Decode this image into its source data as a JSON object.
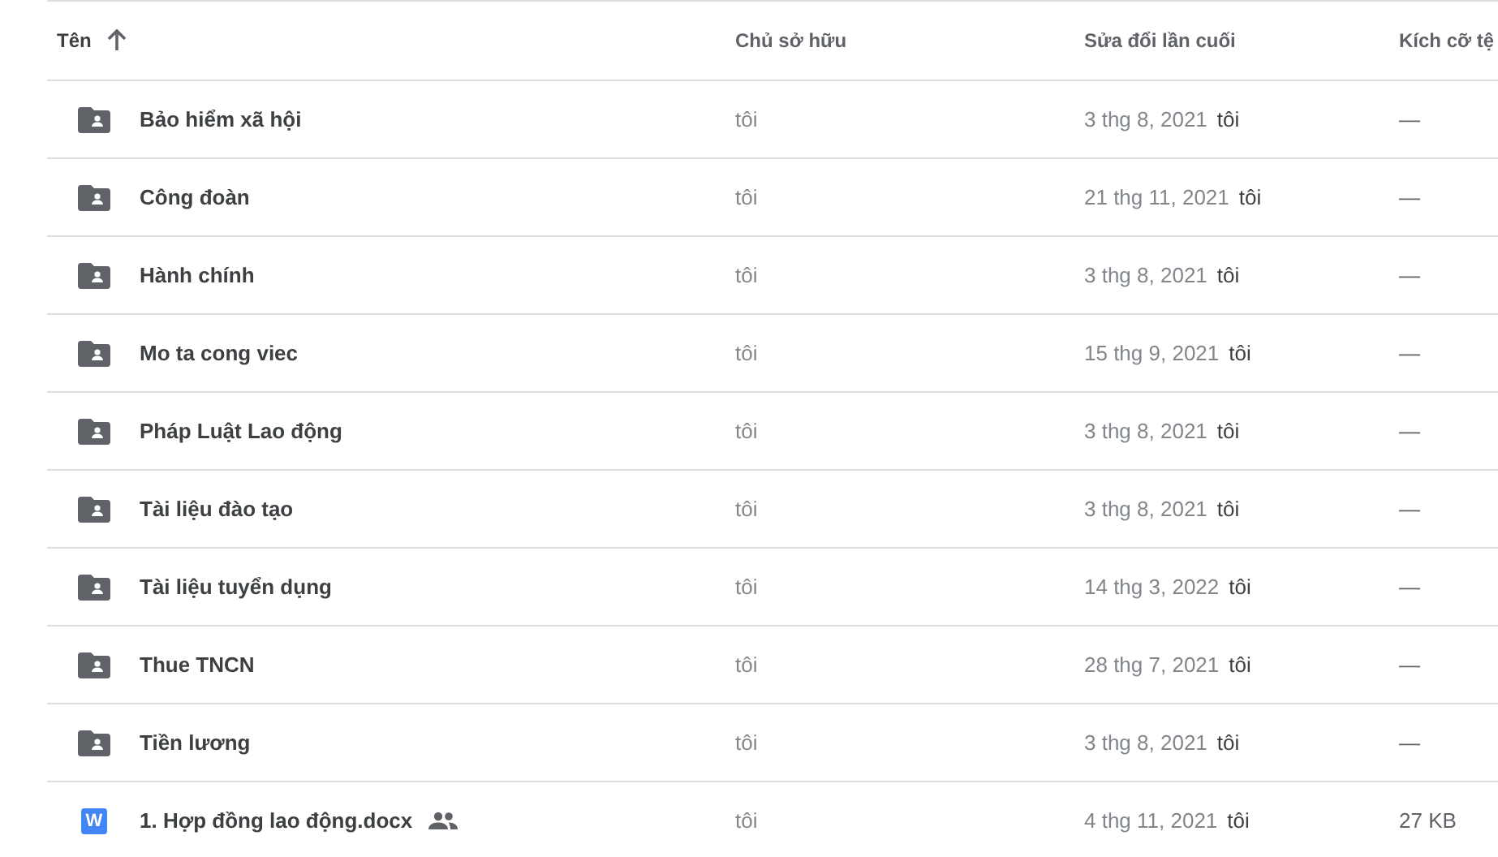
{
  "columns": [
    {
      "label": "Tên",
      "sorted": true
    },
    {
      "label": "Chủ sở hữu",
      "sorted": false
    },
    {
      "label": "Sửa đổi lần cuối",
      "sorted": false
    },
    {
      "label": "Kích cỡ tệ",
      "sorted": false
    }
  ],
  "rows": [
    {
      "kind": "folder",
      "name": "Bảo hiểm xã hội",
      "owner": "tôi",
      "modified": "3 thg 8, 2021",
      "modified_by": "tôi",
      "size": "—",
      "shared": false
    },
    {
      "kind": "folder",
      "name": "Công đoàn",
      "owner": "tôi",
      "modified": "21 thg 11, 2021",
      "modified_by": "tôi",
      "size": "—",
      "shared": false
    },
    {
      "kind": "folder",
      "name": "Hành chính",
      "owner": "tôi",
      "modified": "3 thg 8, 2021",
      "modified_by": "tôi",
      "size": "—",
      "shared": false
    },
    {
      "kind": "folder",
      "name": "Mo ta cong viec",
      "owner": "tôi",
      "modified": "15 thg 9, 2021",
      "modified_by": "tôi",
      "size": "—",
      "shared": false
    },
    {
      "kind": "folder",
      "name": "Pháp Luật Lao động",
      "owner": "tôi",
      "modified": "3 thg 8, 2021",
      "modified_by": "tôi",
      "size": "—",
      "shared": false
    },
    {
      "kind": "folder",
      "name": "Tài liệu đào tạo",
      "owner": "tôi",
      "modified": "3 thg 8, 2021",
      "modified_by": "tôi",
      "size": "—",
      "shared": false
    },
    {
      "kind": "folder",
      "name": "Tài liệu tuyển dụng",
      "owner": "tôi",
      "modified": "14 thg 3, 2022",
      "modified_by": "tôi",
      "size": "—",
      "shared": false
    },
    {
      "kind": "folder",
      "name": "Thue TNCN",
      "owner": "tôi",
      "modified": "28 thg 7, 2021",
      "modified_by": "tôi",
      "size": "—",
      "shared": false
    },
    {
      "kind": "folder",
      "name": "Tiền lương",
      "owner": "tôi",
      "modified": "3 thg 8, 2021",
      "modified_by": "tôi",
      "size": "—",
      "shared": false
    },
    {
      "kind": "word",
      "icon_letter": "W",
      "name": "1. Hợp đồng lao động.docx",
      "owner": "tôi",
      "modified": "4 thg 11, 2021",
      "modified_by": "tôi",
      "size": "27 KB",
      "shared": true
    }
  ]
}
